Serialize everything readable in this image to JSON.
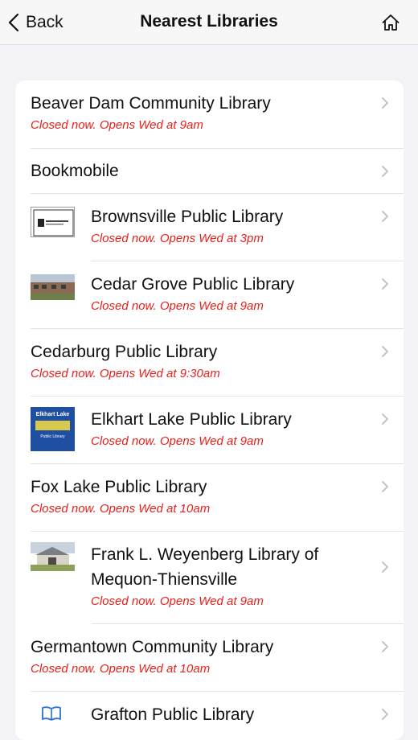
{
  "nav": {
    "back_label": "Back",
    "title": "Nearest Libraries"
  },
  "libraries": [
    {
      "name": "Beaver Dam Community Library",
      "status": "Closed now. Opens Wed at 9am"
    },
    {
      "name": "Bookmobile",
      "status": ""
    },
    {
      "name": "Brownsville Public Library",
      "status": "Closed now. Opens Wed at 3pm"
    },
    {
      "name": "Cedar Grove Public Library",
      "status": "Closed now. Opens Wed at 9am"
    },
    {
      "name": "Cedarburg Public Library",
      "status": "Closed now. Opens Wed at 9:30am"
    },
    {
      "name": "Elkhart Lake Public Library",
      "status": "Closed now. Opens Wed at 9am"
    },
    {
      "name": "Fox Lake Public Library",
      "status": "Closed now. Opens Wed at 10am"
    },
    {
      "name_line1": "Frank L. Weyenberg Library of",
      "name_line2": "Mequon-Thiensville",
      "status": "Closed now. Opens Wed at 9am"
    },
    {
      "name": "Germantown Community Library",
      "status": "Closed now. Opens Wed at 10am"
    },
    {
      "name": "Grafton Public Library",
      "status": ""
    }
  ],
  "logo_text": {
    "elkhart": "Elkhart Lake",
    "elkhart_sub": "Public Library"
  }
}
